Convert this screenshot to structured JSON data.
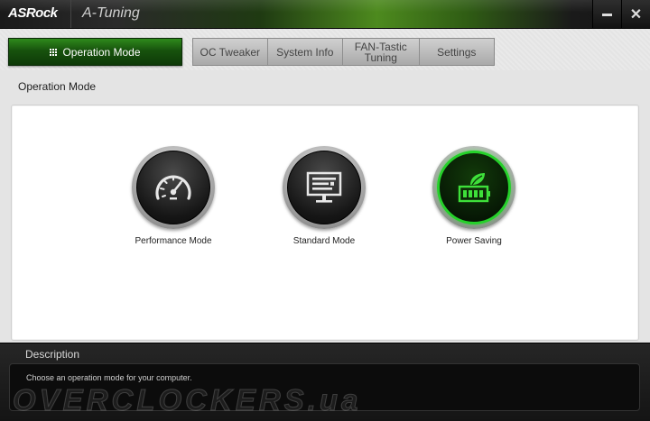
{
  "window": {
    "brand": "ASRock",
    "title": "A-Tuning",
    "minimize_label": "",
    "close_label": "✕"
  },
  "tabs": {
    "active": "Operation Mode",
    "items": [
      "OC Tweaker",
      "System Info",
      "FAN-Tastic Tuning",
      "Settings"
    ]
  },
  "section": {
    "title": "Operation Mode"
  },
  "modes": [
    {
      "label": "Performance Mode",
      "icon": "speedometer-icon",
      "active": false
    },
    {
      "label": "Standard Mode",
      "icon": "monitor-settings-icon",
      "active": false
    },
    {
      "label": "Power Saving",
      "icon": "leaf-battery-icon",
      "active": true
    }
  ],
  "description": {
    "title": "Description",
    "text": "Choose an operation mode for your computer."
  },
  "watermark": "OVERCLOCKERS.ua",
  "colors": {
    "accent_green": "#25d12a",
    "tab_active": "#17520d",
    "title_bar": "#1a1a1a"
  }
}
